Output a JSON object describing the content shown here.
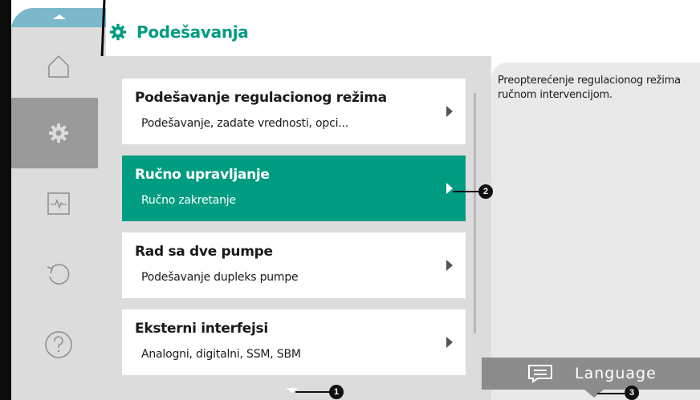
{
  "header": {
    "title": "Podešavanja"
  },
  "sidebar": {
    "items": [
      {
        "icon": "home-icon",
        "active": false
      },
      {
        "icon": "gear-icon",
        "active": true
      },
      {
        "icon": "heartbeat-icon",
        "active": false
      },
      {
        "icon": "undo-icon",
        "active": false
      },
      {
        "icon": "help-icon",
        "active": false
      }
    ]
  },
  "menu": {
    "items": [
      {
        "title": "Podešavanje regulacionog režima",
        "subtitle": "Podešavanje, zadate vrednosti, opci...",
        "selected": false
      },
      {
        "title": "Ručno upravljanje",
        "subtitle": "Ručno zakretanje",
        "selected": true
      },
      {
        "title": "Rad sa dve pumpe",
        "subtitle": "Podešavanje dupleks pumpe",
        "selected": false
      },
      {
        "title": "Eksterni interfejsi",
        "subtitle": "Analogni, digitalni, SSM, SBM",
        "selected": false
      }
    ]
  },
  "help": {
    "text": "Preopterećenje regulacionog režima ručnom intervencijom."
  },
  "language_button": {
    "label": "Language",
    "icon": "chat-bubble-icon"
  },
  "callouts": [
    "1",
    "2",
    "3"
  ],
  "colors": {
    "accent": "#009c82",
    "sidebar": "#dcdcdc",
    "sidebar_active": "#9a9a9a",
    "top_bar": "#7bb8cc"
  }
}
